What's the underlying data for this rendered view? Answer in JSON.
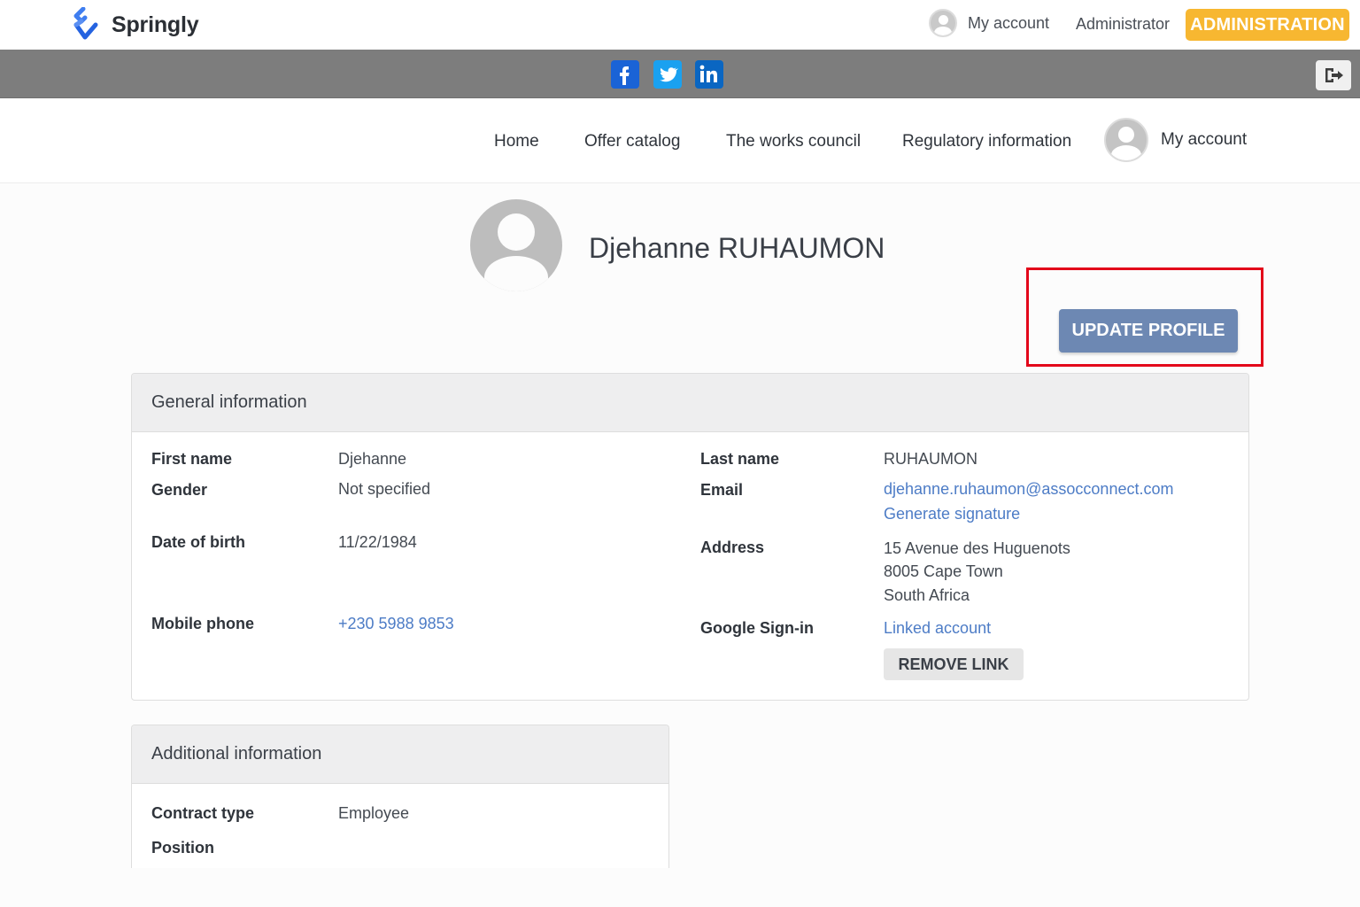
{
  "header": {
    "brand": "Springly",
    "account_label": "My account",
    "admin_user": "Administrator",
    "admin_button": "ADMINISTRATION"
  },
  "social": [
    "facebook-icon",
    "twitter-icon",
    "linkedin-icon"
  ],
  "nav": {
    "items": [
      "Home",
      "Offer catalog",
      "The works council",
      "Regulatory information"
    ],
    "account": "My account"
  },
  "profile": {
    "name": "Djehanne RUHAUMON",
    "update_button": "UPDATE PROFILE"
  },
  "general": {
    "title": "General information",
    "first_name_label": "First name",
    "first_name": "Djehanne",
    "gender_label": "Gender",
    "gender": "Not specified",
    "dob_label": "Date of birth",
    "dob": "11/22/1984",
    "mobile_label": "Mobile phone",
    "mobile": "+230 5988 9853",
    "last_name_label": "Last name",
    "last_name": "RUHAUMON",
    "email_label": "Email",
    "email": "djehanne.ruhaumon@assocconnect.com",
    "signature": "Generate signature",
    "address_label": "Address",
    "address_line1": "15 Avenue des Huguenots",
    "address_line2": "8005 Cape Town",
    "address_line3": "South Africa",
    "google_label": "Google Sign-in",
    "google_value": "Linked account",
    "remove_button": "REMOVE LINK"
  },
  "additional": {
    "title": "Additional information",
    "contract_label": "Contract type",
    "contract": "Employee",
    "position_label": "Position"
  },
  "colors": {
    "accent": "#f7b731",
    "button": "#6d88b3",
    "link": "#4d7cc6",
    "highlight": "#e3061a"
  }
}
